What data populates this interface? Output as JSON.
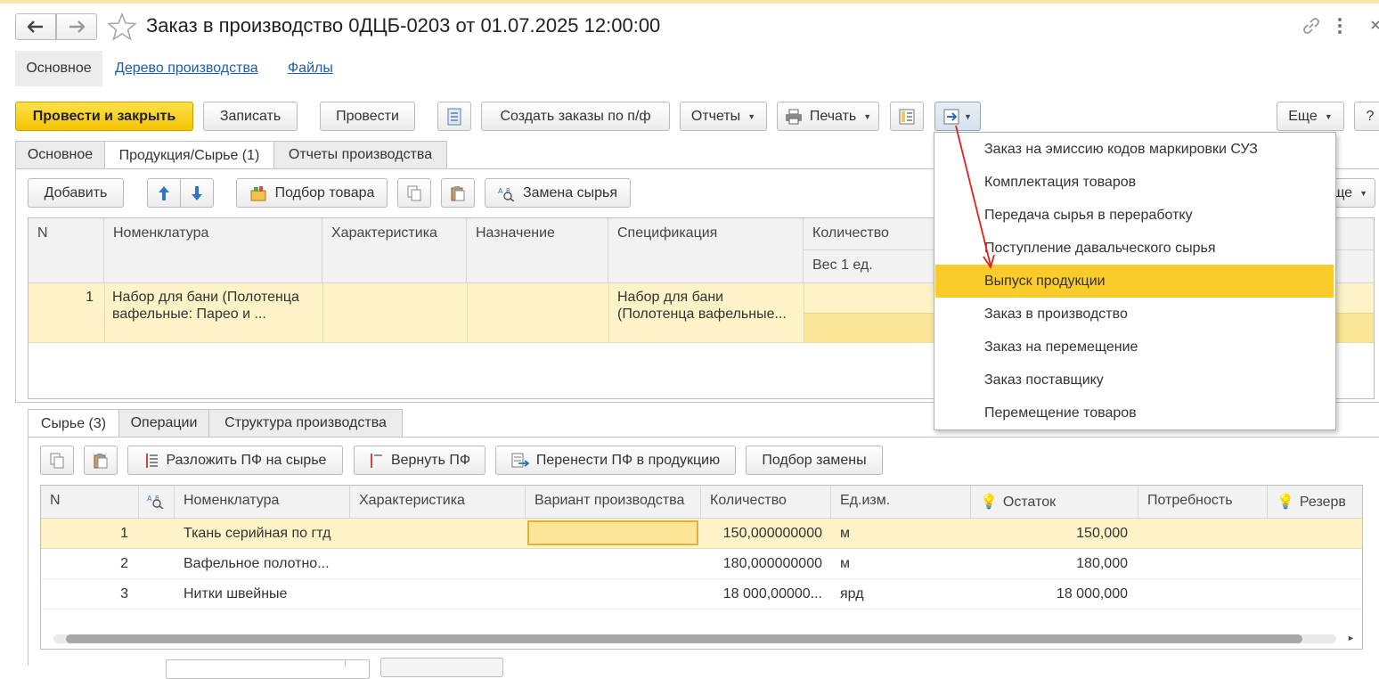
{
  "window": {
    "title": "Заказ в производство 0ДЦБ-0203 от 01.07.2025 12:00:00"
  },
  "nav_tabs": [
    "Основное",
    "Дерево производства",
    "Файлы"
  ],
  "toolbar": {
    "post_close": "Провести и закрыть",
    "save": "Записать",
    "post": "Провести",
    "create_orders": "Создать заказы по п/ф",
    "reports": "Отчеты",
    "print": "Печать",
    "more": "Еще",
    "help": "?"
  },
  "doc_tabs": [
    "Основное",
    "Продукция/Сырье (1)",
    "Отчеты производства"
  ],
  "prod_toolbar": {
    "add": "Добавить",
    "pick": "Подбор товара",
    "replace": "Замена сырья",
    "more": "Еще"
  },
  "prod_table": {
    "columns": [
      "N",
      "Номенклатура",
      "Характеристика",
      "Назначение",
      "Спецификация",
      "Количество"
    ],
    "subheader": "Вес 1 ед.",
    "rows": [
      {
        "n": "1",
        "nomenclature_1": "Набор для бани (Полотенца",
        "nomenclature_2": "вафельные: Парео и ...",
        "spec_1": "Набор для бани",
        "spec_2": "(Полотенца вафельные..."
      }
    ]
  },
  "raw_tabs": [
    "Сырье (3)",
    "Операции",
    "Структура производства"
  ],
  "raw_toolbar": {
    "decompose": "Разложить ПФ на сырье",
    "return_pf": "Вернуть ПФ",
    "move_pf": "Перенести ПФ в продукцию",
    "pick_replace": "Подбор замены"
  },
  "raw_table": {
    "columns": [
      "N",
      "Номенклатура",
      "Характеристика",
      "Вариант производства",
      "Количество",
      "Ед.изм.",
      "Остаток",
      "Потребность",
      "Резерв"
    ],
    "rows": [
      {
        "n": "1",
        "name": "Ткань серийная по гтд",
        "qty": "150,000000000",
        "unit": "м",
        "stock": "150,000"
      },
      {
        "n": "2",
        "name": "Вафельное полотно...",
        "qty": "180,000000000",
        "unit": "м",
        "stock": "180,000"
      },
      {
        "n": "3",
        "name": "Нитки швейные",
        "qty": "18 000,00000...",
        "unit": "ярд",
        "stock": "18 000,000"
      }
    ]
  },
  "dropdown_menu": {
    "items": [
      "Заказ на эмиссию кодов маркировки СУЗ",
      "Комплектация товаров",
      "Передача сырья в переработку",
      "Поступление давальческого сырья",
      "Выпуск продукции",
      "Заказ в производство",
      "Заказ на перемещение",
      "Заказ поставщику",
      "Перемещение товаров"
    ],
    "selected_index": 4
  },
  "colors": {
    "accent": "#f2c400",
    "highlight_row": "#fdf3c6",
    "menu_selected": "#f9cc2c",
    "link": "#1f5ca8",
    "arrow": "#e02020"
  }
}
